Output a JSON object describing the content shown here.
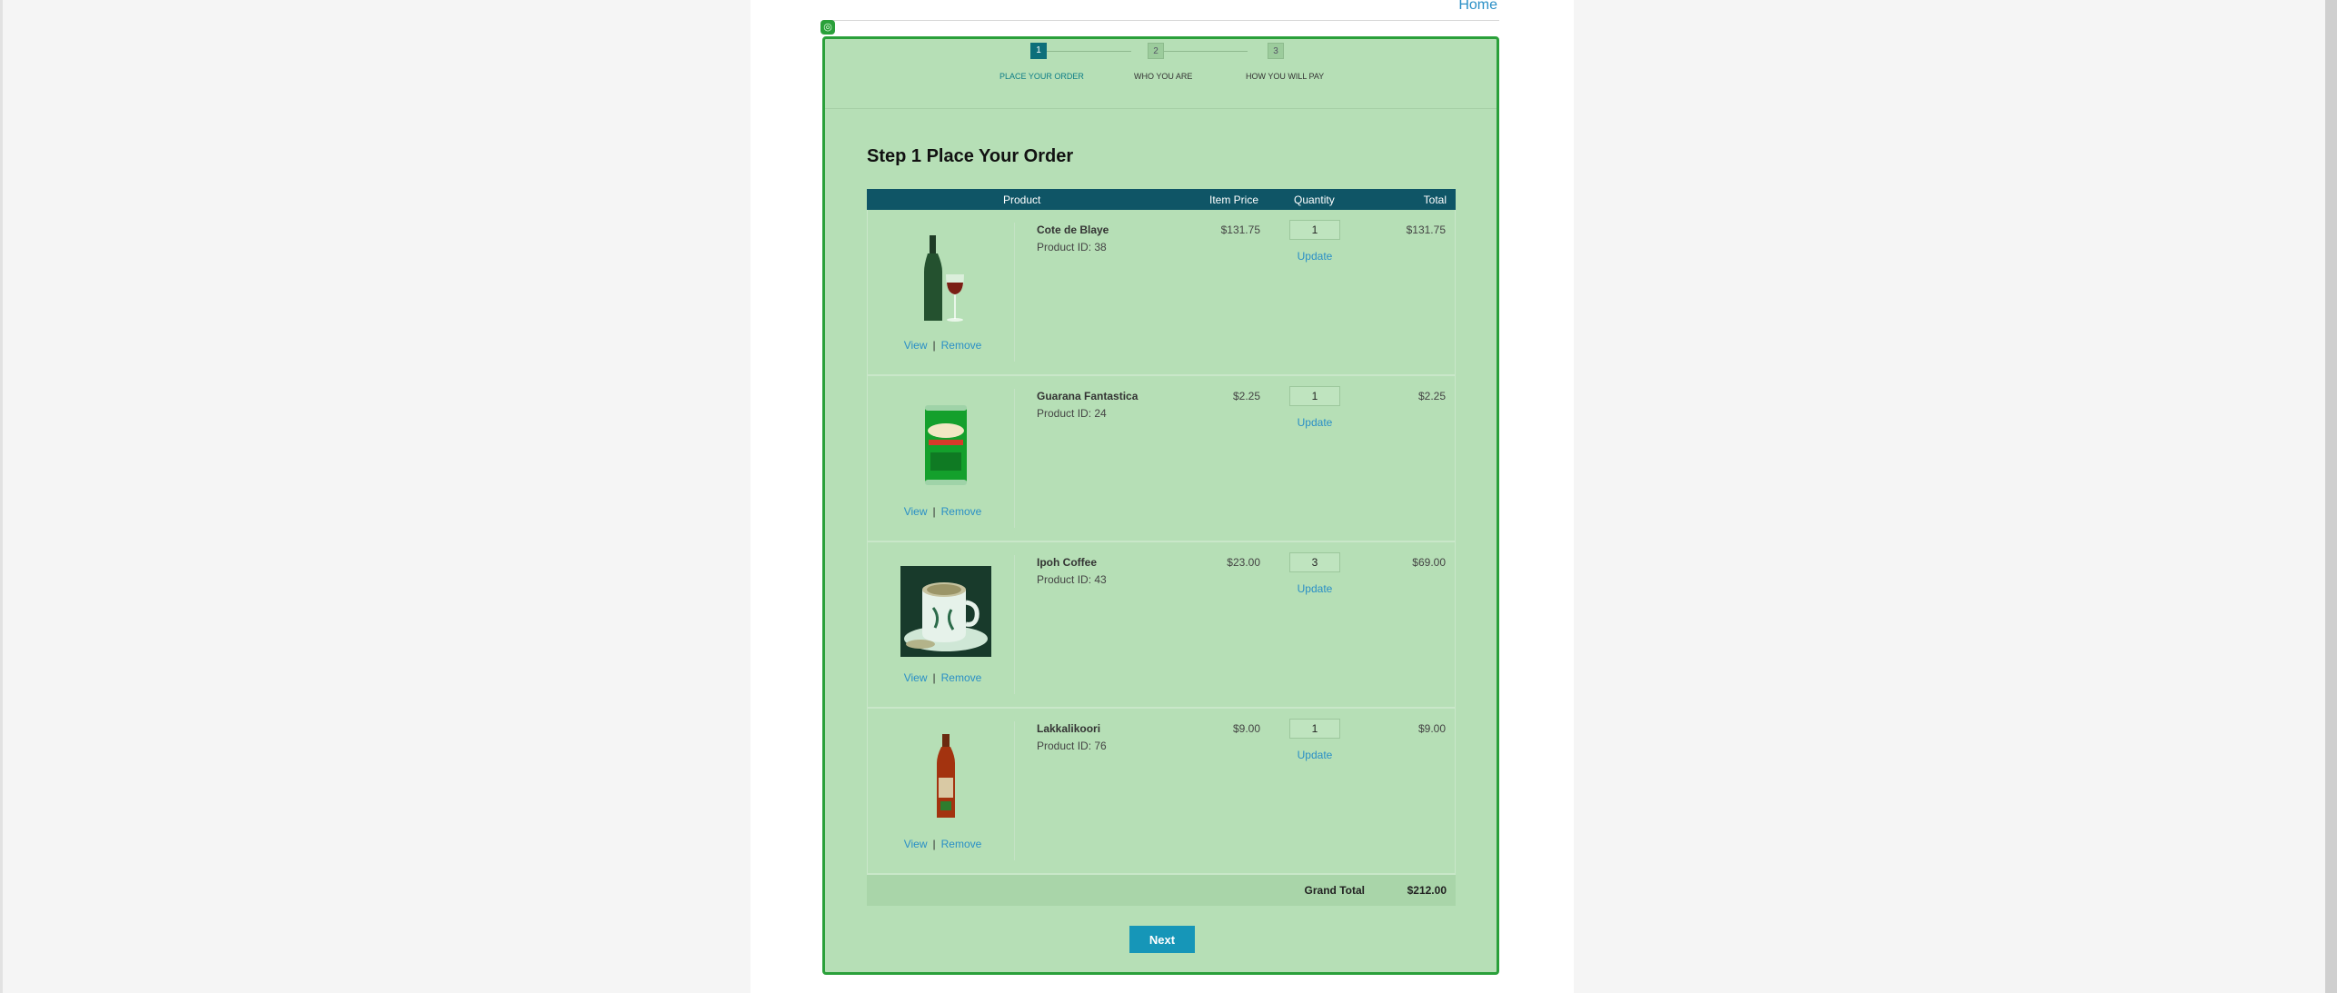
{
  "header": {
    "home_label": "Home"
  },
  "steps": [
    {
      "number": "1",
      "label": "PLACE YOUR ORDER"
    },
    {
      "number": "2",
      "label": "WHO YOU ARE"
    },
    {
      "number": "3",
      "label": "HOW YOU WILL PAY"
    }
  ],
  "title": "Step 1 Place Your Order",
  "table": {
    "headers": {
      "product": "Product",
      "item_price": "Item Price",
      "quantity": "Quantity",
      "total": "Total"
    },
    "rows": [
      {
        "name": "Cote de Blaye",
        "product_id": "Product ID: 38",
        "price": "$131.75",
        "quantity": "1",
        "total": "$131.75",
        "image": "wine-bottle-glass"
      },
      {
        "name": "Guarana Fantastica",
        "product_id": "Product ID: 24",
        "price": "$2.25",
        "quantity": "1",
        "total": "$2.25",
        "image": "soda-can"
      },
      {
        "name": "Ipoh Coffee",
        "product_id": "Product ID: 43",
        "price": "$23.00",
        "quantity": "3",
        "total": "$69.00",
        "image": "coffee-cup"
      },
      {
        "name": "Lakkalikoori",
        "product_id": "Product ID: 76",
        "price": "$9.00",
        "quantity": "1",
        "total": "$9.00",
        "image": "liqueur-bottle"
      }
    ],
    "view_label": "View",
    "separator": "|",
    "remove_label": "Remove",
    "update_label": "Update",
    "grand_total_label": "Grand Total",
    "grand_total_value": "$212.00"
  },
  "next_label": "Next",
  "colors": {
    "panel_bg": "#b6dfb6",
    "panel_border": "#2aa03a",
    "header_bg": "#0f5566",
    "link": "#2a8fc6",
    "button": "#1696b8"
  }
}
